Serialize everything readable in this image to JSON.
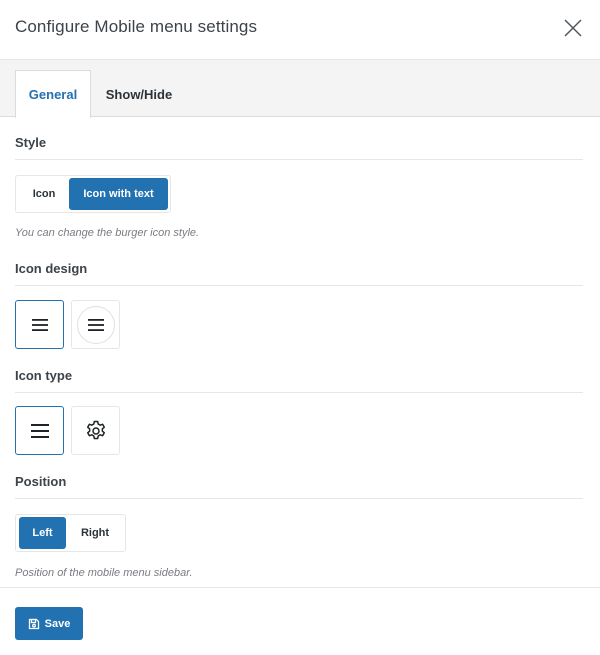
{
  "modal": {
    "title": "Configure Mobile menu settings",
    "close_icon": "close-x-icon"
  },
  "tabs": [
    {
      "label": "General",
      "active": true
    },
    {
      "label": "Show/Hide",
      "active": false
    }
  ],
  "style": {
    "label": "Style",
    "options": [
      {
        "label": "Icon",
        "selected": false
      },
      {
        "label": "Icon with text",
        "selected": true
      }
    ],
    "help": "You can change the burger icon style."
  },
  "icon_design": {
    "label": "Icon design",
    "options": [
      {
        "icon": "hamburger-icon",
        "selected": true
      },
      {
        "icon": "hamburger-circle-icon",
        "selected": false
      }
    ]
  },
  "icon_type": {
    "label": "Icon type",
    "options": [
      {
        "icon": "hamburger-icon",
        "selected": true
      },
      {
        "icon": "gear-icon",
        "selected": false
      }
    ]
  },
  "position": {
    "label": "Position",
    "options": [
      {
        "label": "Left",
        "selected": true
      },
      {
        "label": "Right",
        "selected": false
      }
    ],
    "help": "Position of the mobile menu sidebar."
  },
  "footer": {
    "save_label": "Save",
    "save_icon": "floppy-disk-icon"
  },
  "colors": {
    "accent": "#2271b1",
    "tabs_background": "#f4f4f4",
    "border": "#e6e6e6",
    "help_text": "#787c82"
  }
}
